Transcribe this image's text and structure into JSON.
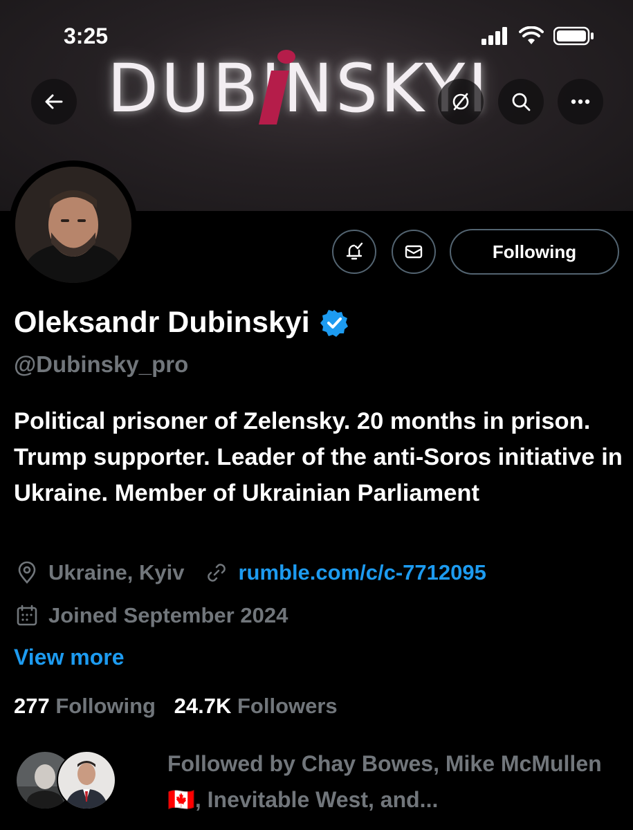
{
  "status_bar": {
    "time": "3:25"
  },
  "banner": {
    "logo_text": "DUBINSKYI"
  },
  "profile": {
    "name": "Oleksandr Dubinskyi",
    "handle": "@Dubinsky_pro",
    "bio": "Political prisoner of Zelensky. 20 months in prison. Trump supporter. Leader of the anti-Soros initiative in Ukraine. Member of Ukrainian Parliament",
    "location": "Ukraine, Kyiv",
    "website": "rumble.com/c/c-7712095",
    "joined": "Joined September 2024",
    "view_more": "View more",
    "following_count": "277",
    "following_label": "Following",
    "followers_count": "24.7K",
    "followers_label": "Followers",
    "followed_by": "Followed by Chay Bowes, Mike McMullen 🇨🇦, Inevitable West, and..."
  },
  "actions": {
    "following_button": "Following"
  },
  "colors": {
    "link": "#1d9bf0",
    "muted": "#71767b",
    "verified": "#1d9bf0",
    "background": "#000000"
  },
  "icons": [
    "back-arrow-icon",
    "translate-icon",
    "search-icon",
    "more-icon",
    "bell-icon",
    "mail-icon",
    "verified-badge-icon",
    "location-icon",
    "link-icon",
    "calendar-icon"
  ]
}
